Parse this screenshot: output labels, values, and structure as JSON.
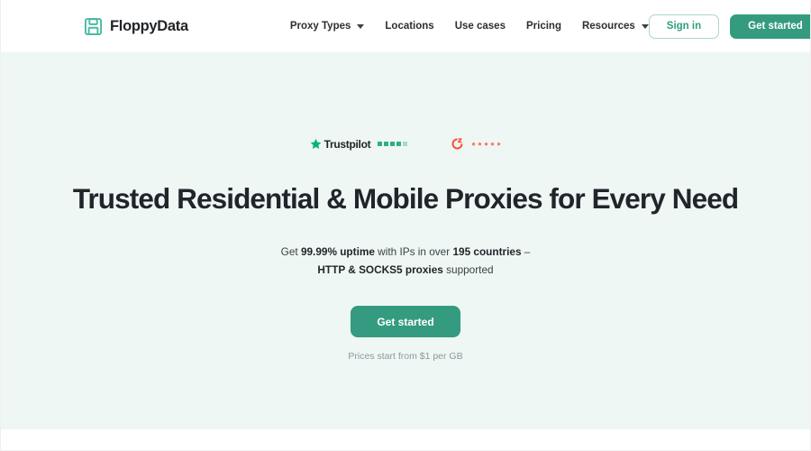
{
  "brand": {
    "name": "FloppyData",
    "icon": "floppy-disk-icon",
    "color": "#4cb8a4"
  },
  "nav": {
    "items": [
      {
        "label": "Proxy Types",
        "has_dropdown": true
      },
      {
        "label": "Locations",
        "has_dropdown": false
      },
      {
        "label": "Use cases",
        "has_dropdown": false
      },
      {
        "label": "Pricing",
        "has_dropdown": false
      },
      {
        "label": "Resources",
        "has_dropdown": true
      }
    ]
  },
  "header_actions": {
    "sign_in_label": "Sign in",
    "get_started_label": "Get started"
  },
  "hero": {
    "badges": [
      {
        "name": "Trustpilot",
        "wordmark": "Trustpilot",
        "star_color": "#00b67a",
        "rating_stars": 5
      },
      {
        "name": "G2",
        "wordmark": "",
        "star_color": "#ff492c",
        "rating_stars": 5
      }
    ],
    "headline": "Trusted Residential & Mobile Proxies for Every Need",
    "subtitle": {
      "line1_pre": "Get ",
      "line1_b1": "99.99% uptime",
      "line1_mid": " with IPs in over ",
      "line1_b2": "195 countries",
      "line1_post": " –",
      "line2_b1": "HTTP & SOCKS5 proxies",
      "line2_post": " supported"
    },
    "cta_label": "Get started",
    "price_note": "Prices start from $1 per GB"
  },
  "colors": {
    "accent": "#349b80",
    "hero_background": "#eef7f3",
    "text_dark": "#21252b",
    "text_muted": "#8a9aa0"
  }
}
